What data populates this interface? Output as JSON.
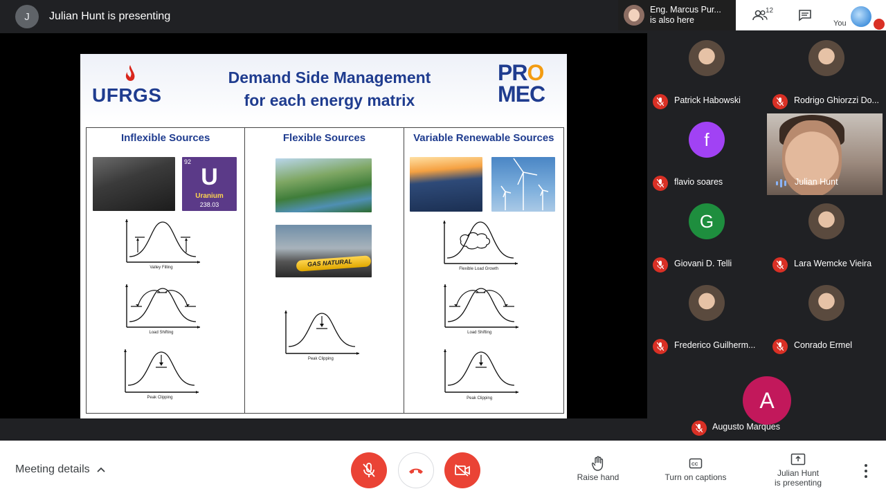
{
  "topbar": {
    "presenter_initial": "J",
    "presenting_label": "Julian Hunt is presenting",
    "also_here_name": "Eng. Marcus Pur...",
    "also_here_sub": "is also here",
    "people_count": "12",
    "you_label": "You"
  },
  "slide": {
    "logo_left": "UFRGS",
    "title_line1": "Demand Side Management",
    "title_line2": "for each energy matrix",
    "logo_right_pr": "PR",
    "logo_right_o": "O",
    "logo_right_mec": "MEC",
    "columns": [
      {
        "title": "Inflexible Sources"
      },
      {
        "title": "Flexible Sources"
      },
      {
        "title": "Variable Renewable Sources"
      }
    ],
    "uranium": {
      "number": "92",
      "symbol": "U",
      "name": "Uranium",
      "mass": "238.03"
    },
    "gas_label": "GAS NATURAL",
    "diagram_labels": {
      "valley_filling": "Valley Filling",
      "load_shifting": "Load Shifting",
      "peak_clipping": "Peak Clipping",
      "flexible_load_growth": "Flexible Load Growth"
    }
  },
  "participants": [
    {
      "name": "Patrick Habowski"
    },
    {
      "name": "Rodrigo Ghiorzzi Do..."
    },
    {
      "name": "flavio soares",
      "initial": "f",
      "color": "#a142f4"
    },
    {
      "name": "Julian Hunt"
    },
    {
      "name": "Giovani D. Telli",
      "initial": "G",
      "color": "#1e8e3e"
    },
    {
      "name": "Lara Wemcke Vieira"
    },
    {
      "name": "Frederico Guilherm..."
    },
    {
      "name": "Conrado Ermel"
    },
    {
      "name": "Augusto Marques",
      "initial": "A",
      "color": "#c2185b"
    }
  ],
  "bottombar": {
    "meeting_details": "Meeting details",
    "raise_hand": "Raise hand",
    "captions": "Turn on captions",
    "presenting_line1": "Julian Hunt",
    "presenting_line2": "is presenting"
  },
  "colors": {
    "danger": "#ea4335",
    "brand_blue": "#1f3c8f"
  }
}
